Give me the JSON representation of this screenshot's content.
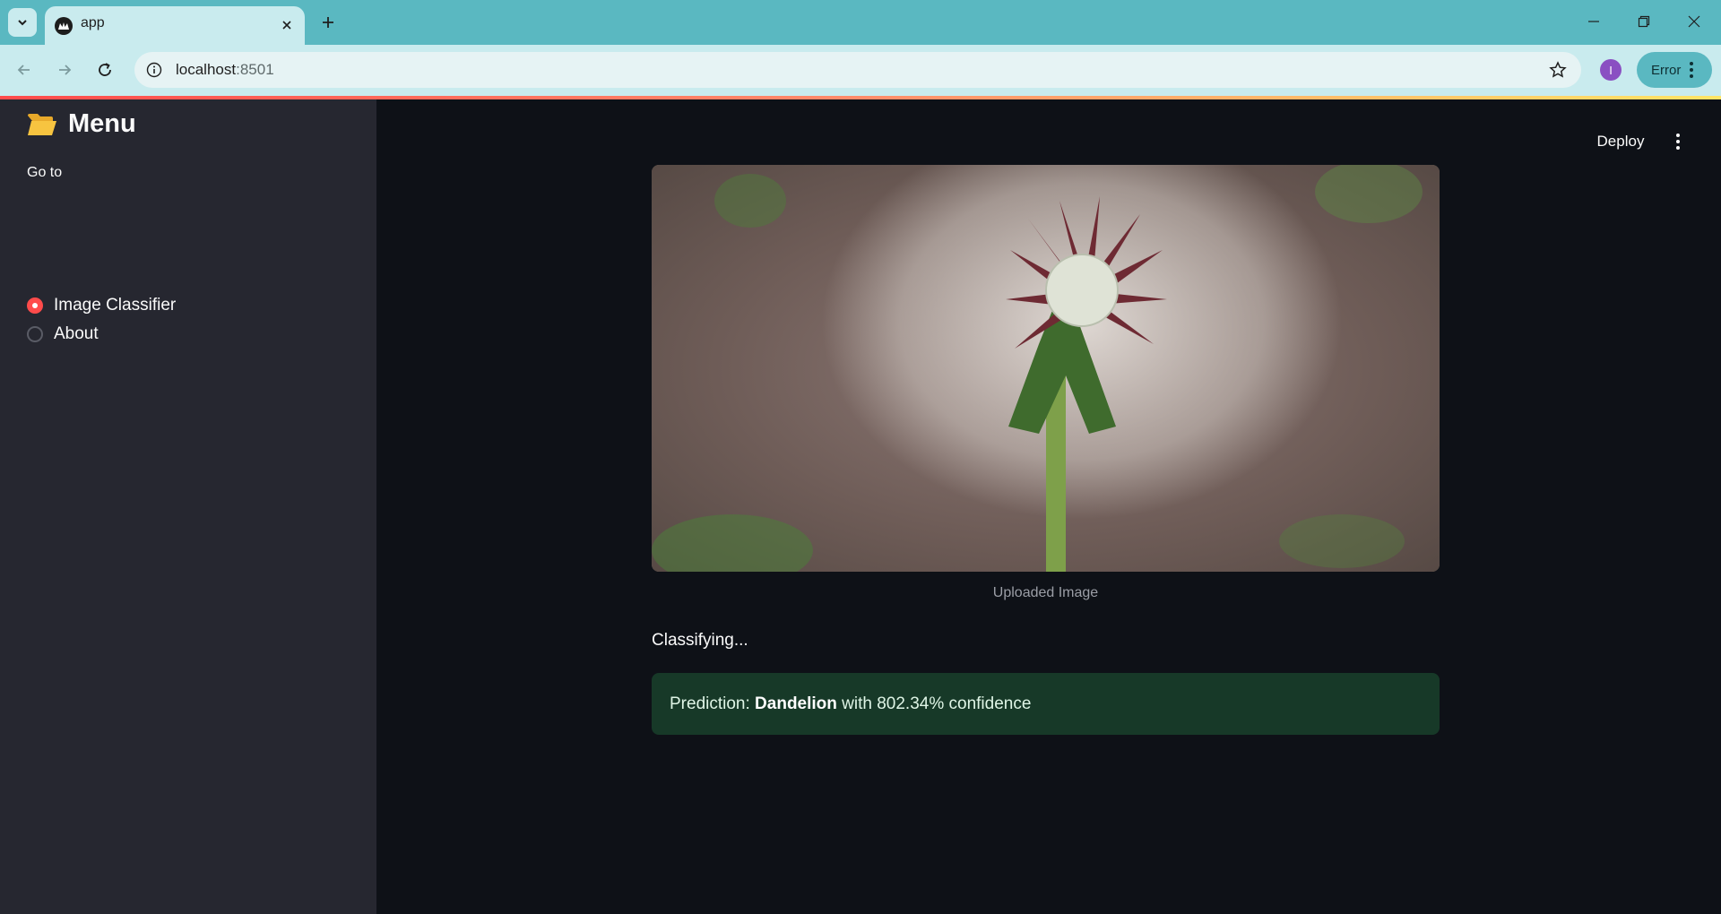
{
  "browser": {
    "tab_title": "app",
    "url_host": "localhost",
    "url_port": ":8501",
    "profile_initial": "I",
    "error_label": "Error"
  },
  "sidebar": {
    "title": "Menu",
    "goto_label": "Go to",
    "options": [
      {
        "label": "Image Classifier",
        "selected": true
      },
      {
        "label": "About",
        "selected": false
      }
    ]
  },
  "header": {
    "deploy_label": "Deploy"
  },
  "main": {
    "image_caption": "Uploaded Image",
    "status_text": "Classifying...",
    "prediction_prefix": "Prediction: ",
    "prediction_class": "Dandelion",
    "prediction_suffix": " with 802.34% confidence"
  },
  "colors": {
    "accent": "#ff4b4b",
    "sidebar_bg": "#262730",
    "main_bg": "#0e1117",
    "success_bg": "#173928"
  }
}
